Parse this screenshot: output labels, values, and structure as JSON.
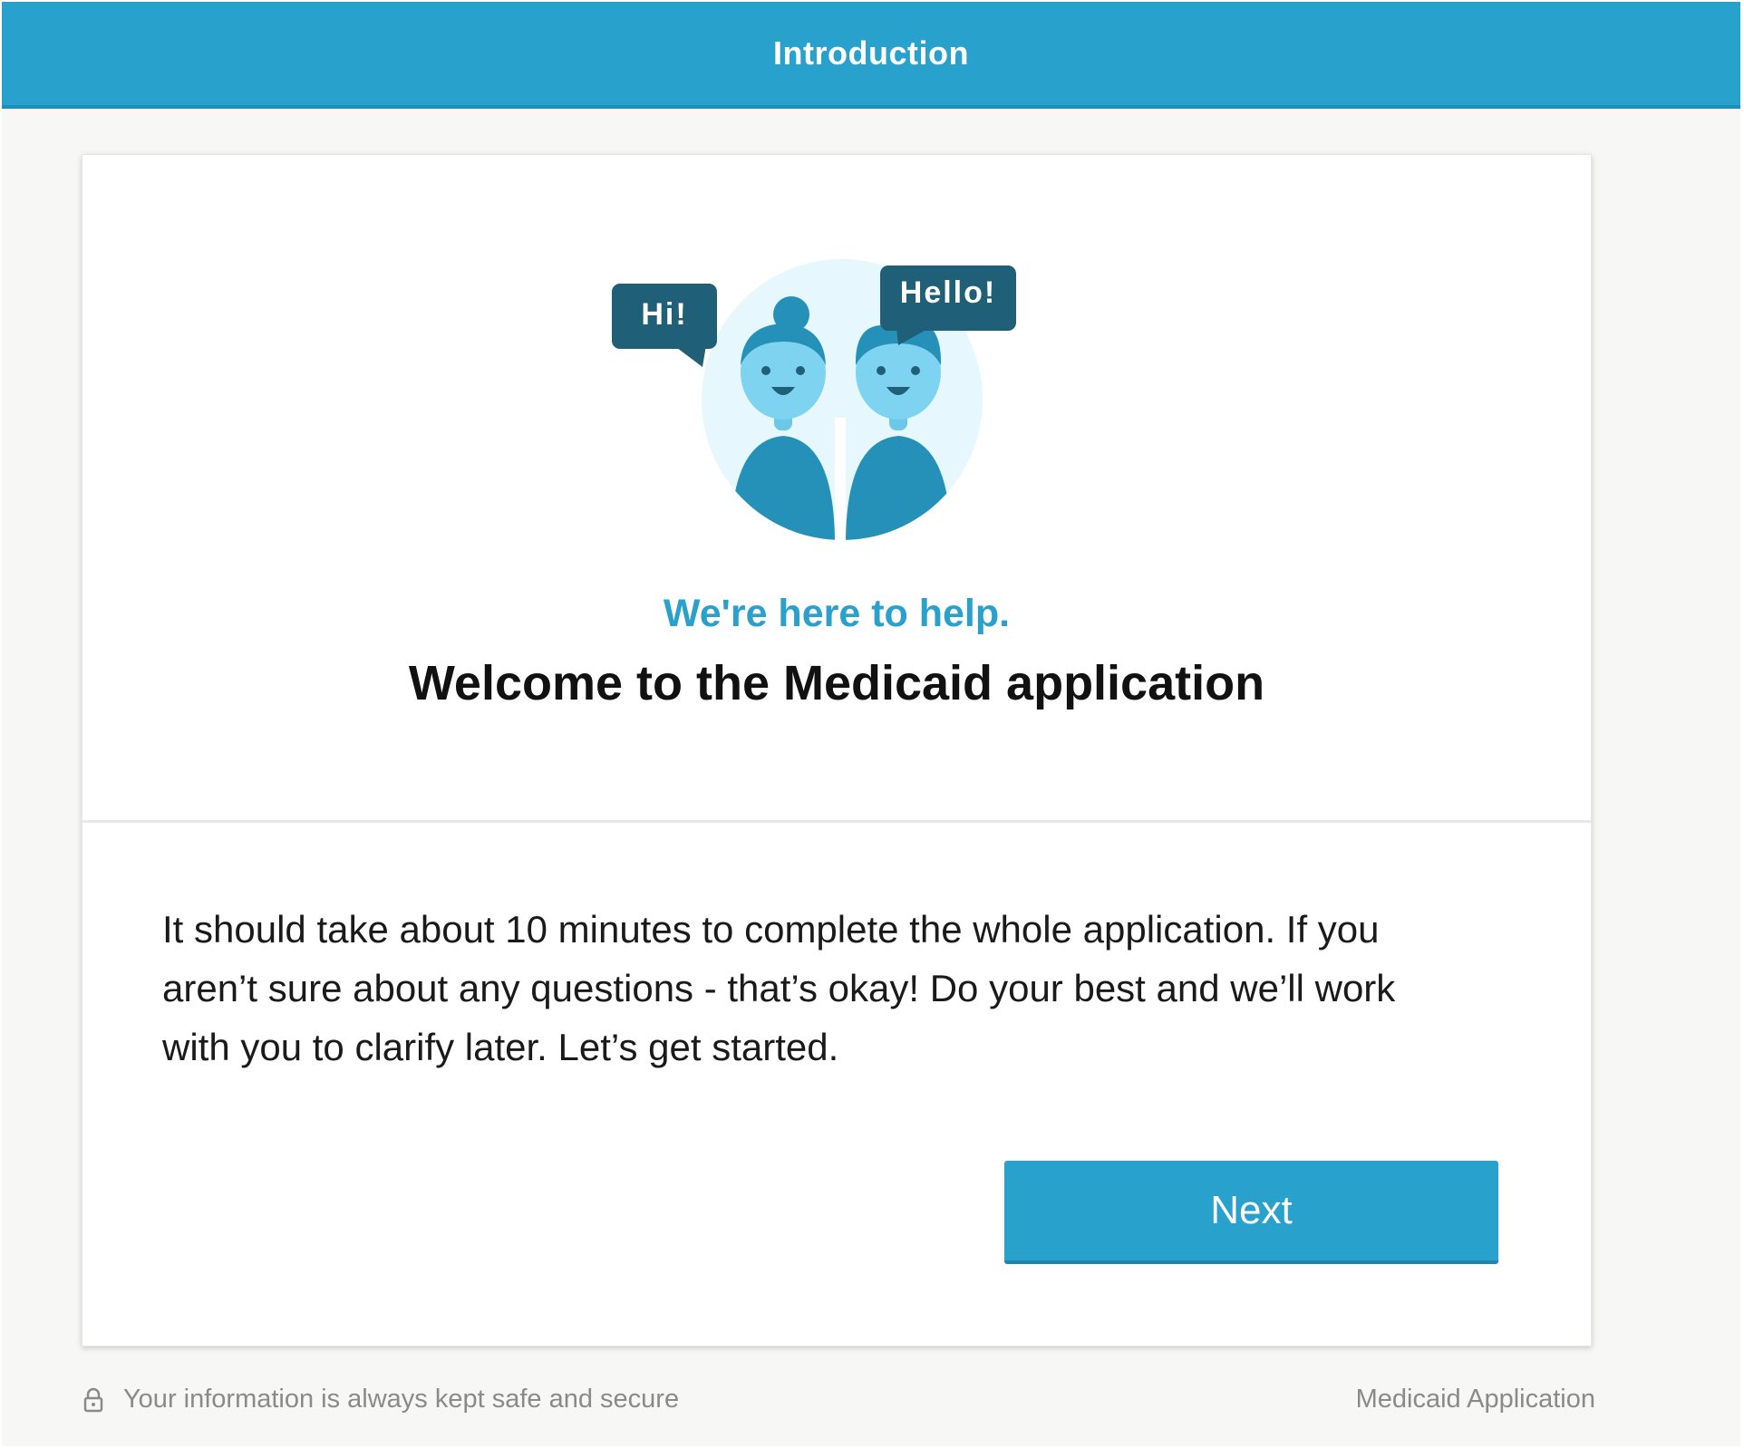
{
  "header": {
    "title": "Introduction"
  },
  "illustration": {
    "bubble_left": "Hi!",
    "bubble_right": "Hello!"
  },
  "intro": {
    "tagline": "We're here to help.",
    "title": "Welcome to the Medicaid application",
    "body": "It should take about 10 minutes to complete the whole application. If you aren’t sure about any questions - that’s okay! Do your best and we’ll work with you to clarify later. Let’s get started.",
    "next_label": "Next"
  },
  "footer": {
    "security_note": "Your information is always kept safe and secure",
    "app_name": "Medicaid Application"
  },
  "colors": {
    "brand": "#28a1cd",
    "bubble": "#1f5f78",
    "figure": "#2590b8",
    "face": "#7dd3f0"
  }
}
